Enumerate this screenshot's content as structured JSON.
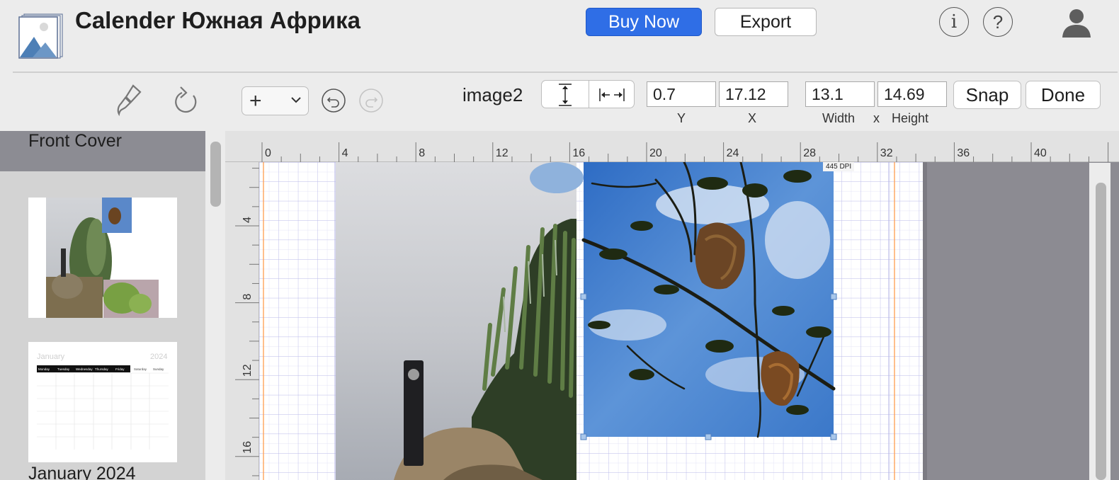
{
  "app": {
    "title": "Calender Южная Африка"
  },
  "header": {
    "buy_now_label": "Buy Now",
    "export_label": "Export",
    "info_symbol": "i",
    "help_symbol": "?",
    "accent_color": "#2f6ee6"
  },
  "toolbar": {
    "add_symbol": "+",
    "element_name": "image2",
    "y_value": "0.7",
    "x_value": "17.12",
    "width_value": "13.1",
    "height_value": "14.69",
    "y_label": "Y",
    "x_label": "X",
    "width_label": "Width",
    "times_label": "x",
    "height_label": "Height",
    "snap_label": "Snap",
    "done_label": "Done",
    "icons": [
      "paintbrush-icon",
      "refresh-icon",
      "plus-icon",
      "chevron-down-icon",
      "undo-icon",
      "redo-icon",
      "fit-height-icon",
      "fit-width-icon"
    ]
  },
  "sidebar": {
    "items": [
      {
        "label": "Front Cover",
        "selected": true
      },
      {
        "label": "January 2024",
        "selected": false
      }
    ],
    "january_thumb": {
      "month": "January",
      "year": "2024",
      "weekdays": [
        "Monday",
        "Tuesday",
        "Wednesday",
        "Thursday",
        "Friday",
        "Saturday",
        "Sunday"
      ]
    }
  },
  "canvas": {
    "h_ruler_ticks": [
      "0",
      "4",
      "8",
      "12",
      "16",
      "20",
      "24",
      "28",
      "32",
      "36",
      "40"
    ],
    "v_ruler_ticks": [
      "4",
      "8",
      "12",
      "16"
    ],
    "dpi_label": "445 DPI",
    "images": [
      "cactus-photo",
      "weaver-nests-photo"
    ]
  }
}
